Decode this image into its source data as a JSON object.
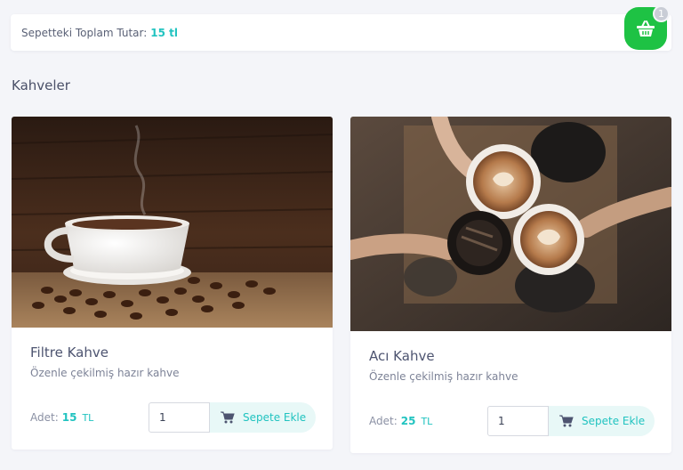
{
  "header": {
    "total_label": "Sepetteki Toplam Tutar:",
    "total_value": "15 tl"
  },
  "cart": {
    "count": "1",
    "icon": "basket-icon",
    "color": "#1ec244"
  },
  "section": {
    "title": "Kahveler"
  },
  "products": [
    {
      "name": "Filtre Kahve",
      "description": "Özenle çekilmiş hazır kahve",
      "price_label": "Adet:",
      "price": "15",
      "currency": "TL",
      "quantity": "1",
      "button_label": "Sepete Ekle"
    },
    {
      "name": "Acı Kahve",
      "description": "Özenle çekilmiş hazır kahve",
      "price_label": "Adet:",
      "price": "25",
      "currency": "TL",
      "quantity": "1",
      "button_label": "Sepete Ekle"
    }
  ],
  "colors": {
    "accent": "#21c3c0",
    "background": "#f4f5f9"
  }
}
